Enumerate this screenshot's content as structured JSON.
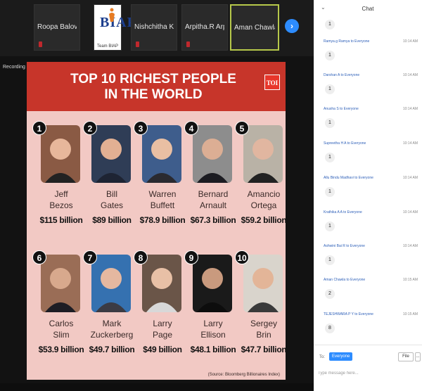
{
  "participants": [
    {
      "name": "Roopa Balove...",
      "muted": true
    },
    {
      "name": "BIAP",
      "tag": "Team BIAP",
      "logo": true
    },
    {
      "name": "Nishchitha K R",
      "muted": true
    },
    {
      "name": "Arpitha.R Arpi...",
      "muted": true
    },
    {
      "name": "Aman Chawla",
      "active": true
    }
  ],
  "recording_label": "Recording",
  "slide": {
    "title_line1": "TOP 10 RICHEST PEOPLE",
    "title_line2": "IN THE WORLD",
    "badge": "TOI",
    "people": [
      {
        "rank": "1",
        "first": "Jeff",
        "last": "Bezos",
        "worth": "$115 billion"
      },
      {
        "rank": "2",
        "first": "Bill",
        "last": "Gates",
        "worth": "$89 billion"
      },
      {
        "rank": "3",
        "first": "Warren",
        "last": "Buffett",
        "worth": "$78.9 billion"
      },
      {
        "rank": "4",
        "first": "Bernard",
        "last": "Arnault",
        "worth": "$67.3 billion"
      },
      {
        "rank": "5",
        "first": "Amancio",
        "last": "Ortega",
        "worth": "$59.2 billion"
      },
      {
        "rank": "6",
        "first": "Carlos",
        "last": "Slim",
        "worth": "$53.9 billion"
      },
      {
        "rank": "7",
        "first": "Mark",
        "last": "Zuckerberg",
        "worth": "$49.7 billion"
      },
      {
        "rank": "8",
        "first": "Larry",
        "last": "Page",
        "worth": "$49 billion"
      },
      {
        "rank": "9",
        "first": "Larry",
        "last": "Ellison",
        "worth": "$48.1 billion"
      },
      {
        "rank": "10",
        "first": "Sergey",
        "last": "Brin",
        "worth": "$47.7 billion"
      }
    ],
    "source": "(Source: Bloomberg Billionaires Index)"
  },
  "chat": {
    "title": "Chat",
    "first_message": "1",
    "messages": [
      {
        "sender": "Ramya.g Ramya to Everyone",
        "time": "10:14 AM",
        "text": "1"
      },
      {
        "sender": "Darshan A to Everyone",
        "time": "10:14 AM",
        "text": "1"
      },
      {
        "sender": "Anusha S to Everyone",
        "time": "10:14 AM",
        "text": "1"
      },
      {
        "sender": "Supreetha H A to Everyone",
        "time": "10:14 AM",
        "text": "1"
      },
      {
        "sender": "Allu Bindu Madhavi to Everyone",
        "time": "10:14 AM",
        "text": "1"
      },
      {
        "sender": "Krathika A A to Everyone",
        "time": "10:14 AM",
        "text": "1"
      },
      {
        "sender": "Ashwini Bai R to Everyone",
        "time": "10:14 AM",
        "text": "1"
      },
      {
        "sender": "Aman Chawla to Everyone",
        "time": "10:15 AM",
        "text": "2"
      },
      {
        "sender": "TEJESHWARA P Y to Everyone",
        "time": "10:15 AM",
        "text": "8"
      }
    ],
    "to_label": "To:",
    "recipient": "Everyone",
    "file_label": "File",
    "more_label": "...",
    "input_placeholder": "Type message here..."
  }
}
